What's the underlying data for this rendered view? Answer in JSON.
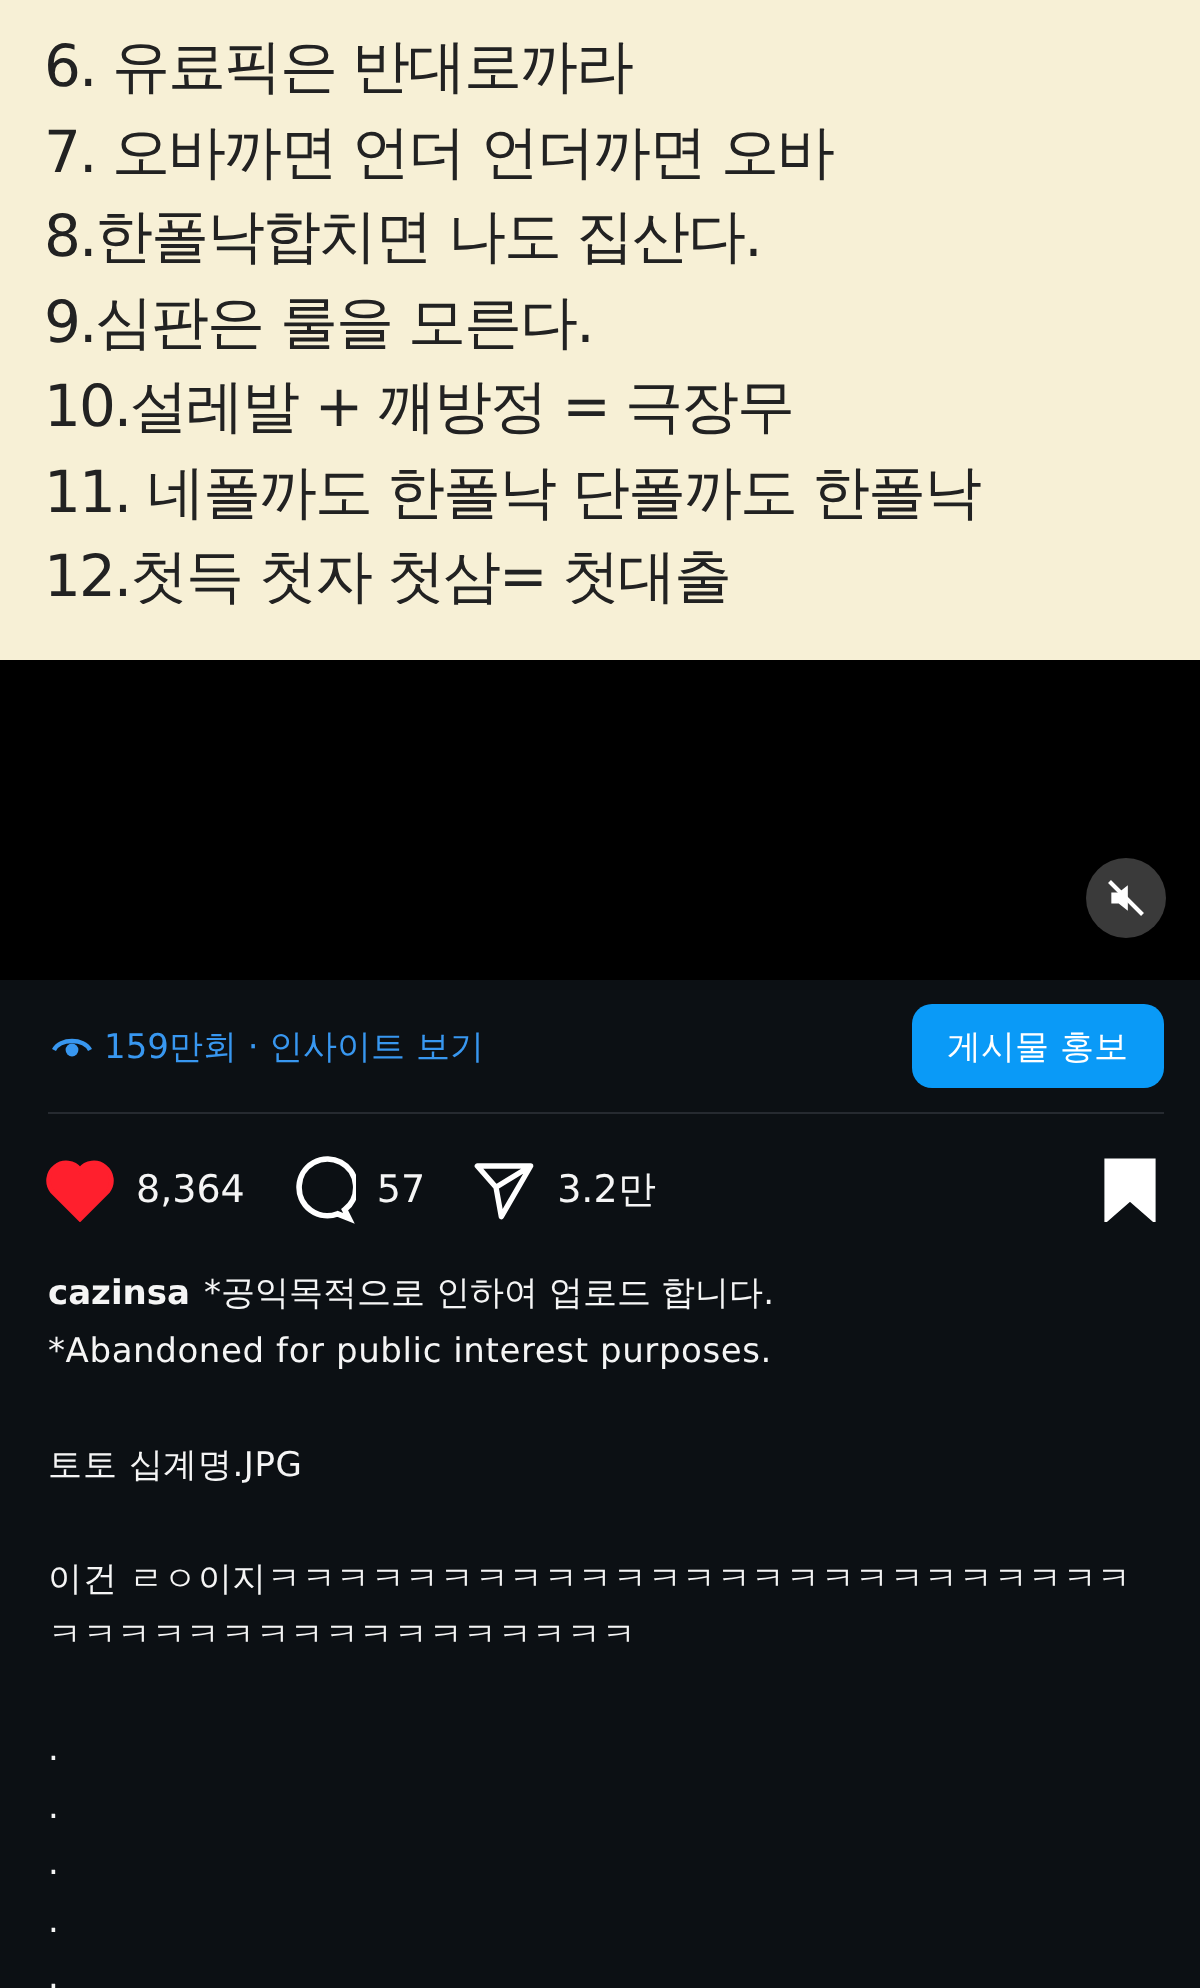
{
  "media": {
    "lines": [
      "6. 유료픽은 반대로까라",
      "7. 오바까면 언더 언더까면 오바",
      "8.한폴낙합치면 나도 집산다.",
      "9.심판은 룰을 모른다.",
      "10.설레발 + 깨방정 = 극장무",
      "11. 네폴까도 한폴낙 단폴까도 한폴낙",
      "12.첫득 첫자 첫삼= 첫대출"
    ],
    "muted": true
  },
  "insights": {
    "text": "159만회 · 인사이트 보기",
    "button": "게시물 홍보"
  },
  "actions": {
    "liked": true,
    "likes": "8,364",
    "comments": "57",
    "shares": "3.2만",
    "saved": true
  },
  "caption": {
    "username": "cazinsa",
    "first_line": "*공익목적으로 인하여 업로드 합니다.",
    "second_line": "*Abandoned for public interest purposes.",
    "paragraphs": [
      {
        "lines": [
          "토토 십계명.JPG"
        ]
      },
      {
        "lines": [
          "이건 ㄹㅇ이지ㅋㅋㅋㅋㅋㅋㅋㅋㅋㅋㅋㅋㅋㅋㅋㅋㅋㅋㅋㅋㅋㅋㅋㅋㅋㅋㅋㅋㅋㅋㅋㅋㅋㅋㅋㅋㅋㅋㅋㅋㅋㅋ"
        ]
      },
      {
        "lines": [
          ".",
          ".",
          ".",
          ".",
          "."
        ]
      }
    ]
  }
}
